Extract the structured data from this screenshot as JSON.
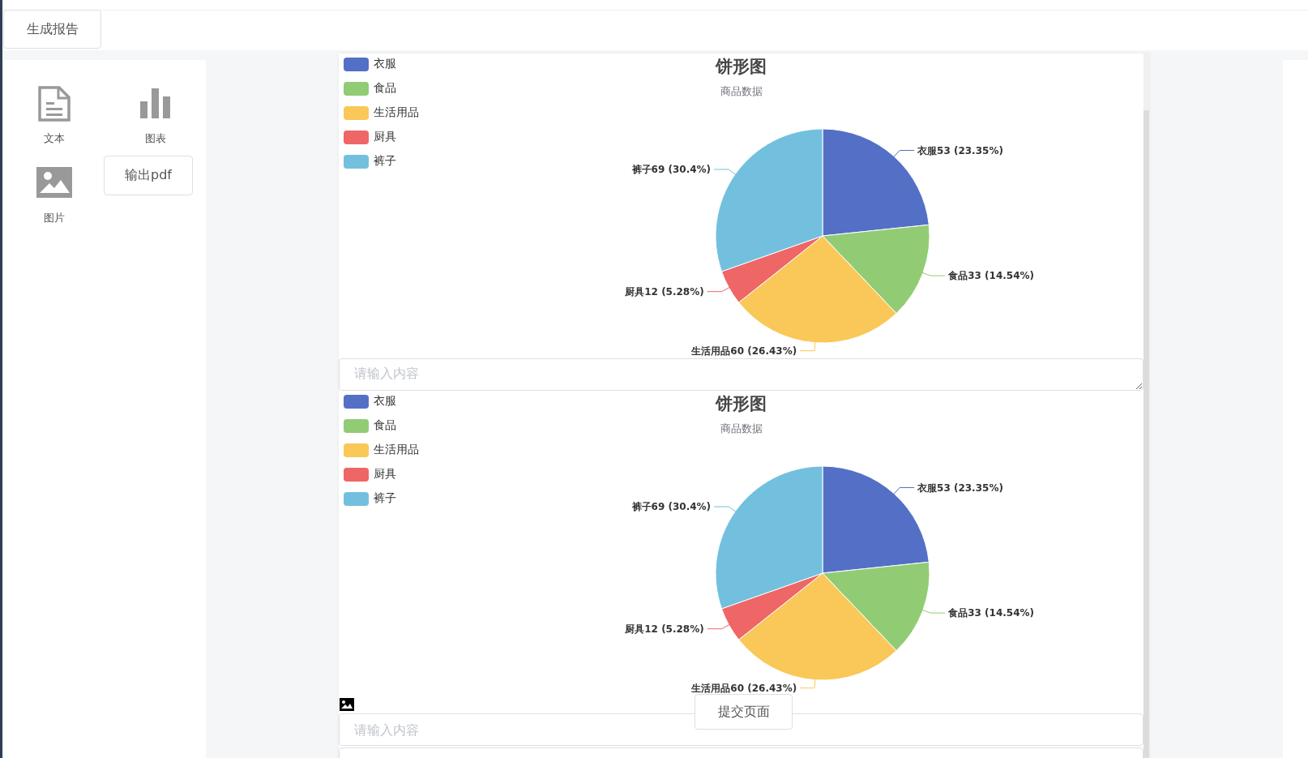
{
  "header": {
    "generate_button": "生成报告"
  },
  "toolbox": {
    "tools": [
      {
        "kind": "text",
        "label": "文本"
      },
      {
        "kind": "chart",
        "label": "图表"
      },
      {
        "kind": "image",
        "label": "图片"
      }
    ],
    "export_button": "输出pdf"
  },
  "blocks": [
    {
      "kind": "chart",
      "chart_data": {
        "type": "pie",
        "title": "饼形图",
        "subtitle": "商品数据",
        "legend": true,
        "categories": [
          "衣服",
          "食品",
          "生活用品",
          "厨具",
          "裤子"
        ],
        "values": [
          53,
          33,
          60,
          12,
          69
        ],
        "colors": [
          "#5470c6",
          "#91cc75",
          "#fac858",
          "#ee6666",
          "#73c0de"
        ],
        "value_labels": [
          "衣服53 (23.35%)",
          "食品33 (14.54%)",
          "生活用品60 (26.43%)",
          "厨具12 (5.28%)",
          "裤子69 (30.4%)"
        ]
      }
    },
    {
      "kind": "textarea",
      "placeholder": "请输入内容"
    },
    {
      "kind": "chart",
      "chart_data": {
        "type": "pie",
        "title": "饼形图",
        "subtitle": "商品数据",
        "legend": true,
        "categories": [
          "衣服",
          "食品",
          "生活用品",
          "厨具",
          "裤子"
        ],
        "values": [
          53,
          33,
          60,
          12,
          69
        ],
        "colors": [
          "#5470c6",
          "#91cc75",
          "#fac858",
          "#ee6666",
          "#73c0de"
        ],
        "value_labels": [
          "衣服53 (23.35%)",
          "食品33 (14.54%)",
          "生活用品60 (26.43%)",
          "厨具12 (5.28%)",
          "裤子69 (30.4%)"
        ]
      }
    },
    {
      "kind": "image"
    },
    {
      "kind": "input",
      "placeholder": "请输入内容"
    },
    {
      "kind": "input"
    }
  ],
  "submit_button": "提交页面"
}
